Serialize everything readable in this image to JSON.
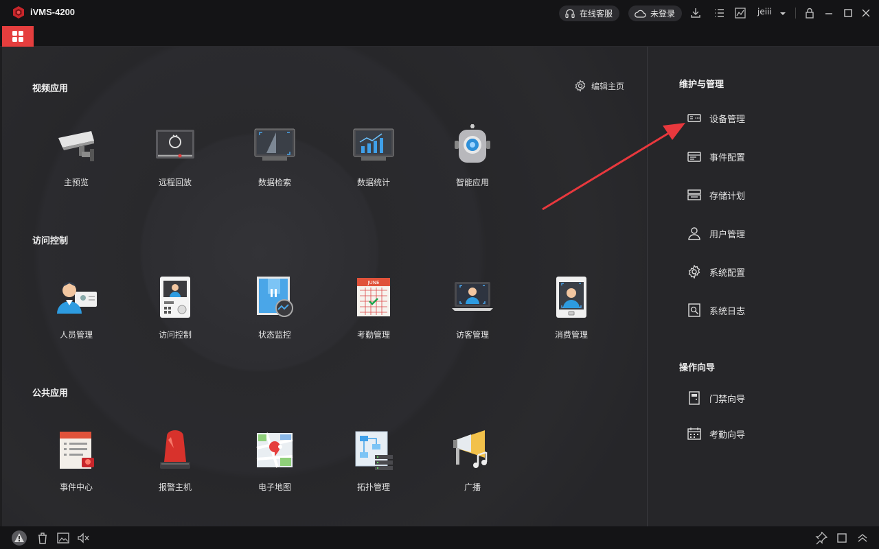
{
  "window": {
    "title": "iVMS-4200",
    "online_service": "在线客服",
    "login_status": "未登录",
    "username": "jeiii"
  },
  "main": {
    "edit_home": "编辑主页",
    "sections": [
      {
        "title": "视频应用",
        "apps": [
          {
            "label": "主预览",
            "icon": "camera-icon"
          },
          {
            "label": "远程回放",
            "icon": "playback-icon"
          },
          {
            "label": "数据检索",
            "icon": "search-data-icon"
          },
          {
            "label": "数据统计",
            "icon": "statistics-icon"
          },
          {
            "label": "智能应用",
            "icon": "robot-icon"
          }
        ]
      },
      {
        "title": "访问控制",
        "apps": [
          {
            "label": "人员管理",
            "icon": "person-card-icon"
          },
          {
            "label": "访问控制",
            "icon": "door-terminal-icon"
          },
          {
            "label": "状态监控",
            "icon": "door-monitor-icon"
          },
          {
            "label": "考勤管理",
            "icon": "calendar-icon"
          },
          {
            "label": "访客管理",
            "icon": "laptop-face-icon"
          },
          {
            "label": "消费管理",
            "icon": "face-terminal-icon"
          }
        ]
      },
      {
        "title": "公共应用",
        "apps": [
          {
            "label": "事件中心",
            "icon": "event-center-icon"
          },
          {
            "label": "报警主机",
            "icon": "alarm-light-icon"
          },
          {
            "label": "电子地图",
            "icon": "map-icon"
          },
          {
            "label": "拓扑管理",
            "icon": "topology-icon"
          },
          {
            "label": "广播",
            "icon": "broadcast-icon"
          }
        ]
      }
    ]
  },
  "sidebar": {
    "maintenance_title": "维护与管理",
    "maintenance_items": [
      {
        "label": "设备管理",
        "icon": "device-icon"
      },
      {
        "label": "事件配置",
        "icon": "event-config-icon"
      },
      {
        "label": "存储计划",
        "icon": "storage-icon"
      },
      {
        "label": "用户管理",
        "icon": "user-icon"
      },
      {
        "label": "系统配置",
        "icon": "gear-icon"
      },
      {
        "label": "系统日志",
        "icon": "log-icon"
      }
    ],
    "guide_title": "操作向导",
    "guide_items": [
      {
        "label": "门禁向导",
        "icon": "door-guide-icon"
      },
      {
        "label": "考勤向导",
        "icon": "attendance-guide-icon"
      }
    ]
  },
  "colors": {
    "accent": "#e53e3e",
    "annotation_arrow": "#e8383d"
  }
}
